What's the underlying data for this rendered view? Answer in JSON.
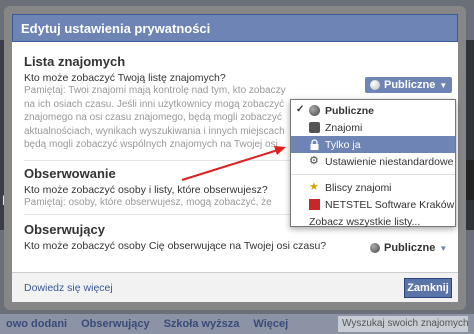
{
  "dialog": {
    "title": "Edytuj ustawienia prywatności",
    "footer_link": "Dowiedz się więcej",
    "close_label": "Zamknij"
  },
  "friends_list": {
    "title": "Lista znajomych",
    "question": "Kto może zobaczyć Twoją listę znajomych?",
    "note_lines": [
      "Pamiętaj: Twoi znajomi mają kontrolę nad tym, kto zobaczy",
      "na ich osiach czasu. Jeśli inni użytkownicy mogą zobaczyć",
      "znajomego na osi czasu znajomego, będą mogli zobaczyć",
      "aktualnościach, wynikach wyszukiwania i innych miejscach",
      "będą mogli zobaczyć wspólnych znajomych na Twojej osi"
    ],
    "setting": "Publiczne"
  },
  "following": {
    "title": "Obserwowanie",
    "question": "Kto może zobaczyć osoby i listy, które obserwujesz?",
    "note": "Pamiętaj: osoby, które obserwujesz, mogą zobaczyć, że"
  },
  "followers": {
    "title": "Obserwujący",
    "question": "Kto może zobaczyć osoby Cię obserwujące na Twojej osi czasu?",
    "setting": "Publiczne"
  },
  "dropdown": {
    "items": [
      {
        "label": "Publiczne",
        "icon": "globe-icon",
        "checked": true
      },
      {
        "label": "Znajomi",
        "icon": "friends-icon"
      },
      {
        "label": "Tylko ja",
        "icon": "lock-icon",
        "highlighted": true
      },
      {
        "label": "Ustawienie niestandardowe",
        "icon": "gear-icon"
      }
    ],
    "lists": [
      {
        "label": "Bliscy znajomi",
        "icon": "star-icon"
      },
      {
        "label": "NETSTEL Software Kraków",
        "icon": "company-icon"
      }
    ],
    "see_all": "Zobacz wszystkie listy..."
  },
  "background": {
    "nav_items": [
      "owo dodani",
      "Obserwujący",
      "Szkoła wyższa",
      "Więcej"
    ],
    "search_placeholder": "Wyszukaj swoich znajomych",
    "side_letter": "K"
  },
  "colors": {
    "title_bar": "#6d84b4",
    "accent_button": "#5b74a8",
    "arrow": "#e02020"
  }
}
